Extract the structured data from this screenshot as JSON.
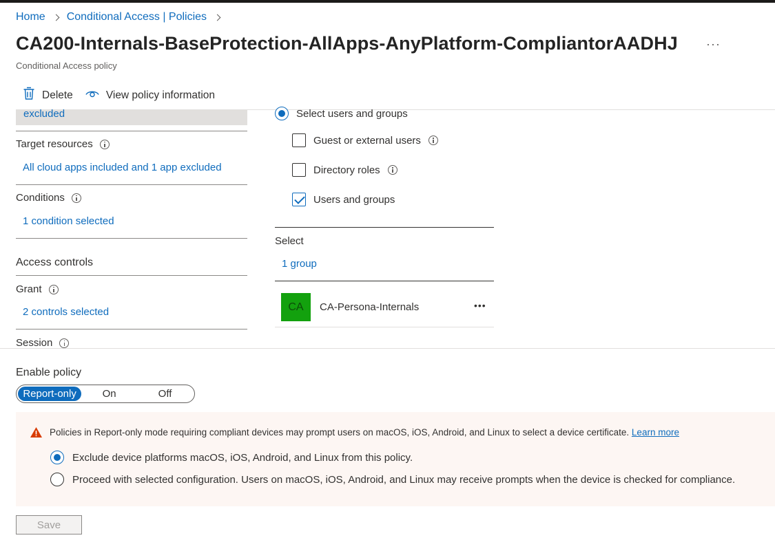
{
  "breadcrumb": {
    "home": "Home",
    "policies": "Conditional Access | Policies"
  },
  "page": {
    "title": "CA200-Internals-BaseProtection-AllApps-AnyPlatform-CompliantorAADHJ",
    "subtitle": "Conditional Access policy",
    "more": "···"
  },
  "toolbar": {
    "delete_label": "Delete",
    "view_info_label": "View policy information"
  },
  "left": {
    "users_summary": "excluded",
    "target_resources_label": "Target resources",
    "target_resources_value": "All cloud apps included and 1 app excluded",
    "conditions_label": "Conditions",
    "conditions_value": "1 condition selected",
    "access_controls_heading": "Access controls",
    "grant_label": "Grant",
    "grant_value": "2 controls selected",
    "session_label": "Session"
  },
  "right": {
    "select_users_label": "Select users and groups",
    "guest_label": "Guest or external users",
    "directory_roles_label": "Directory roles",
    "users_groups_label": "Users and groups",
    "select_label": "Select",
    "group_count": "1 group",
    "group": {
      "initials": "CA",
      "name": "CA-Persona-Internals",
      "more": "•••"
    }
  },
  "enable_policy": {
    "label": "Enable policy",
    "options": [
      "Report-only",
      "On",
      "Off"
    ],
    "selected": "Report-only"
  },
  "warning": {
    "text": "Policies in Report-only mode requiring compliant devices may prompt users on macOS, iOS, Android, and Linux to select a device certificate.",
    "link": "Learn more",
    "option_exclude": "Exclude device platforms macOS, iOS, Android, and Linux from this policy.",
    "option_proceed": "Proceed with selected configuration. Users on macOS, iOS, Android, and Linux may receive prompts when the device is checked for compliance."
  },
  "save_label": "Save",
  "colors": {
    "accent": "#0f6cbd",
    "avatar": "#13a10e",
    "warning_bg": "#fdf6f3",
    "warning_icon": "#d83b01"
  }
}
